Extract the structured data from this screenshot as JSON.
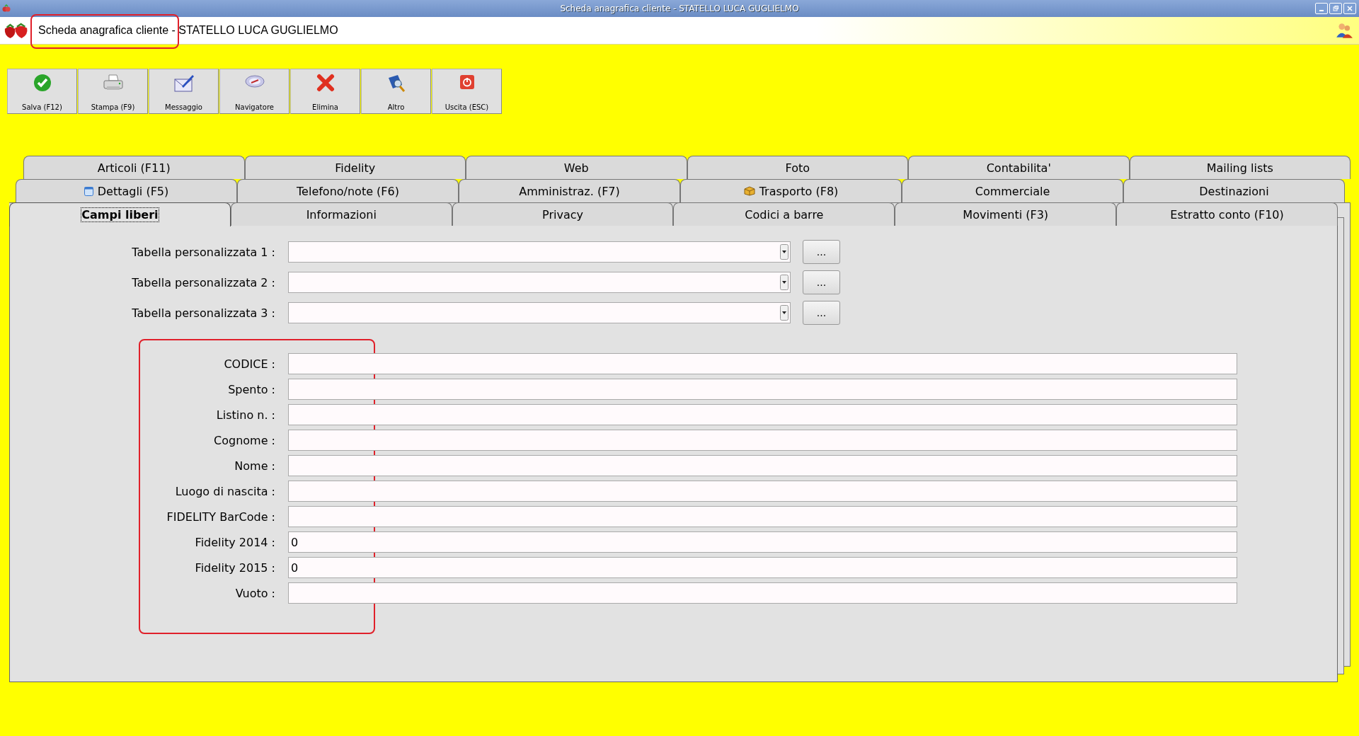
{
  "window": {
    "title": "Scheda anagrafica cliente - STATELLO LUCA GUGLIELMO"
  },
  "header": {
    "title": "Scheda anagrafica cliente - STATELLO LUCA GUGLIELMO"
  },
  "toolbar": [
    {
      "label": "Salva (F12)",
      "kind": "check"
    },
    {
      "label": "Stampa (F9)",
      "kind": "printer"
    },
    {
      "label": "Messaggio",
      "kind": "envelope"
    },
    {
      "label": "Navigatore",
      "kind": "compass"
    },
    {
      "label": "Elimina",
      "kind": "cross"
    },
    {
      "label": "Altro",
      "kind": "book"
    },
    {
      "label": "Uscita (ESC)",
      "kind": "power"
    }
  ],
  "tab_rows": [
    [
      {
        "label": "Articoli (F11)",
        "selected": false,
        "kind": "plain"
      },
      {
        "label": "Fidelity",
        "selected": false,
        "kind": "plain"
      },
      {
        "label": "Web",
        "selected": false,
        "kind": "plain"
      },
      {
        "label": "Foto",
        "selected": false,
        "kind": "plain"
      },
      {
        "label": "Contabilita'",
        "selected": false,
        "kind": "plain"
      },
      {
        "label": "Mailing lists",
        "selected": false,
        "kind": "plain"
      }
    ],
    [
      {
        "label": "Dettagli (F5)",
        "selected": false,
        "kind": "calendar"
      },
      {
        "label": "Telefono/note (F6)",
        "selected": false,
        "kind": "plain"
      },
      {
        "label": "Amministraz. (F7)",
        "selected": false,
        "kind": "plain"
      },
      {
        "label": "Trasporto (F8)",
        "selected": false,
        "kind": "parcel"
      },
      {
        "label": "Commerciale",
        "selected": false,
        "kind": "plain"
      },
      {
        "label": "Destinazioni",
        "selected": false,
        "kind": "plain"
      }
    ],
    [
      {
        "label": "Campi liberi",
        "selected": true,
        "kind": "plain"
      },
      {
        "label": "Informazioni",
        "selected": false,
        "kind": "plain"
      },
      {
        "label": "Privacy",
        "selected": false,
        "kind": "plain"
      },
      {
        "label": "Codici a barre",
        "selected": false,
        "kind": "plain"
      },
      {
        "label": "Movimenti (F3)",
        "selected": false,
        "kind": "plain"
      },
      {
        "label": "Estratto conto (F10)",
        "selected": false,
        "kind": "plain"
      }
    ]
  ],
  "custom_tables": [
    {
      "label": "Tabella personalizzata 1 :",
      "button": "..."
    },
    {
      "label": "Tabella personalizzata 2 :",
      "button": "..."
    },
    {
      "label": "Tabella personalizzata 3 :",
      "button": "..."
    }
  ],
  "fields": [
    {
      "label": "CODICE :"
    },
    {
      "label": "Spento :"
    },
    {
      "label": "Listino n. :"
    },
    {
      "label": "Cognome :"
    },
    {
      "label": "Nome :"
    },
    {
      "label": "Luogo di nascita :"
    },
    {
      "label": "FIDELITY BarCode :"
    },
    {
      "label": "Fidelity 2014 :",
      "value": "0"
    },
    {
      "label": "Fidelity 2015 :",
      "value": "0"
    },
    {
      "label": "Vuoto :"
    }
  ]
}
